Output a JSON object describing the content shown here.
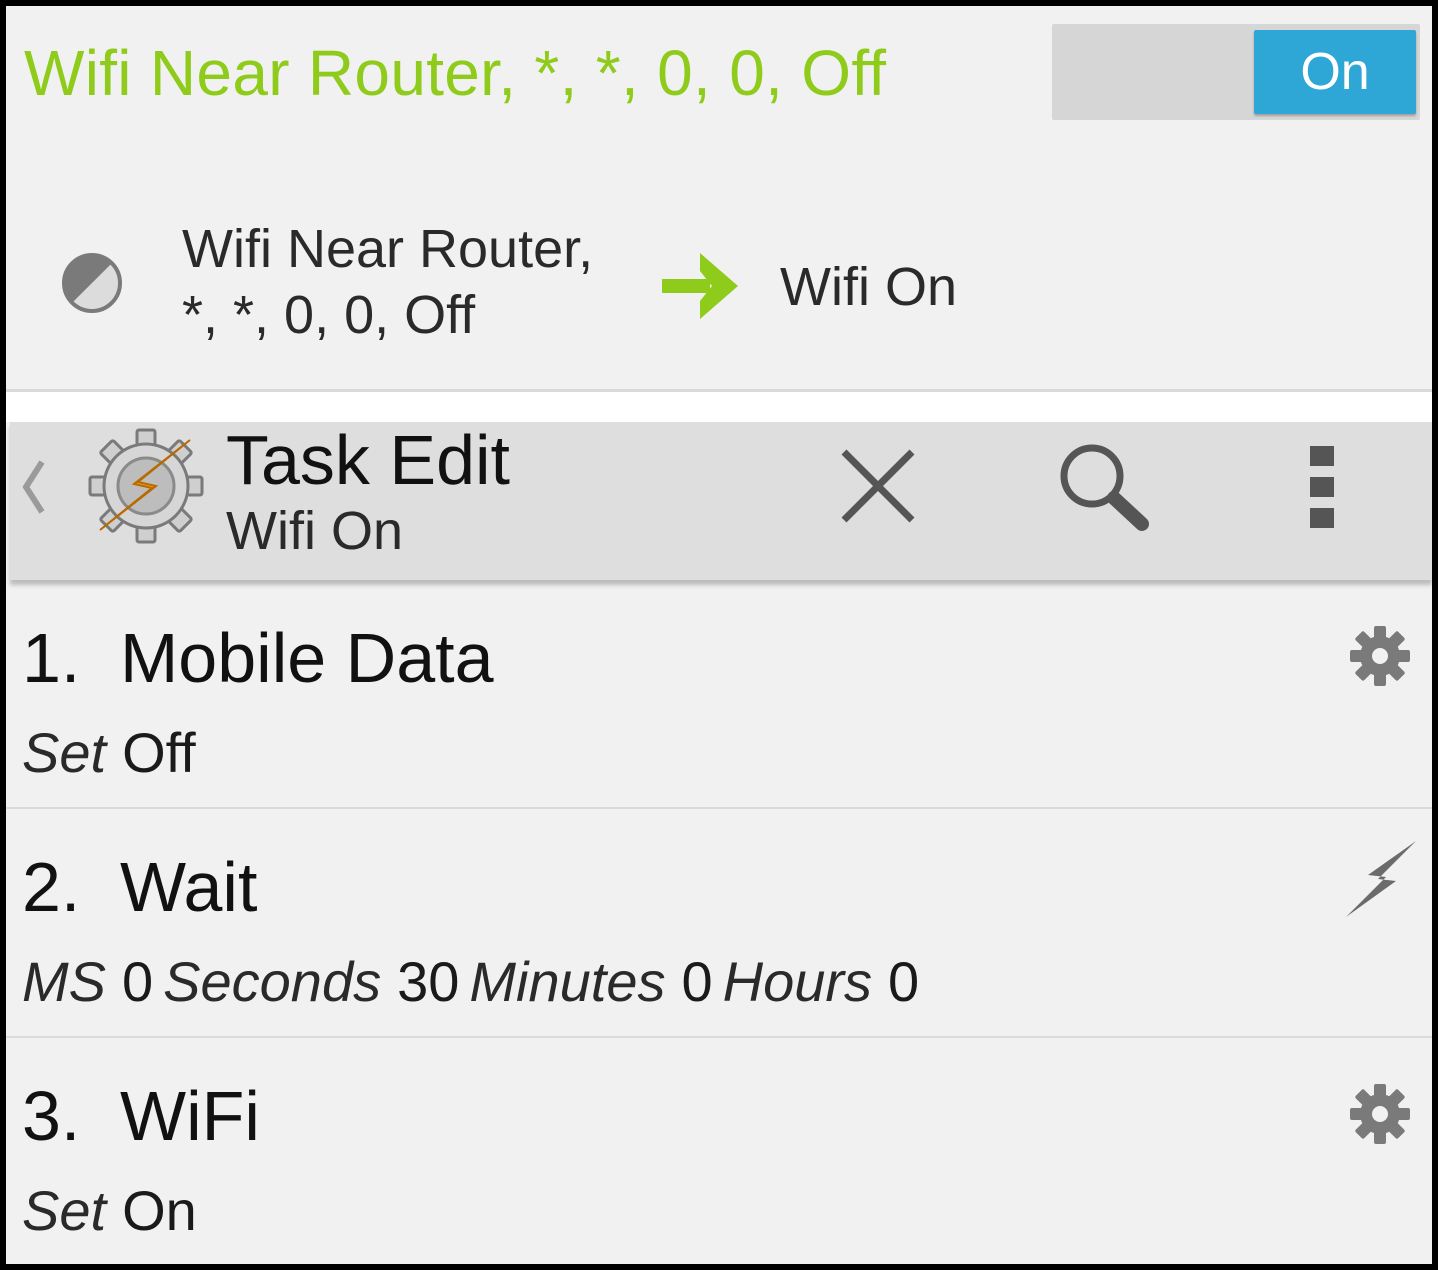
{
  "profile": {
    "title": "Wifi Near Router, *, *, 0, 0, Off",
    "toggle_label": "On",
    "context_line1": "Wifi Near Router,",
    "context_line2": "*, *, 0, 0, Off",
    "task": "Wifi On",
    "title_color": "#8fcb1a",
    "toggle_color": "#2ea6d6"
  },
  "actionbar": {
    "title": "Task Edit",
    "subtitle": "Wifi On",
    "icons": [
      "back-chevron-icon",
      "tasker-app-icon",
      "close-icon",
      "search-icon",
      "overflow-menu-icon"
    ]
  },
  "actions": [
    {
      "number": "1.",
      "name": "Mobile Data",
      "icon": "gear-icon",
      "args": [
        {
          "label": "Set",
          "value": "Off"
        }
      ]
    },
    {
      "number": "2.",
      "name": "Wait",
      "icon": "lightning-icon",
      "args": [
        {
          "label": "MS",
          "value": "0"
        },
        {
          "label": "Seconds",
          "value": "30"
        },
        {
          "label": "Minutes",
          "value": "0"
        },
        {
          "label": "Hours",
          "value": "0"
        }
      ]
    },
    {
      "number": "3.",
      "name": "WiFi",
      "icon": "gear-icon",
      "args": [
        {
          "label": "Set",
          "value": "On"
        }
      ]
    }
  ]
}
